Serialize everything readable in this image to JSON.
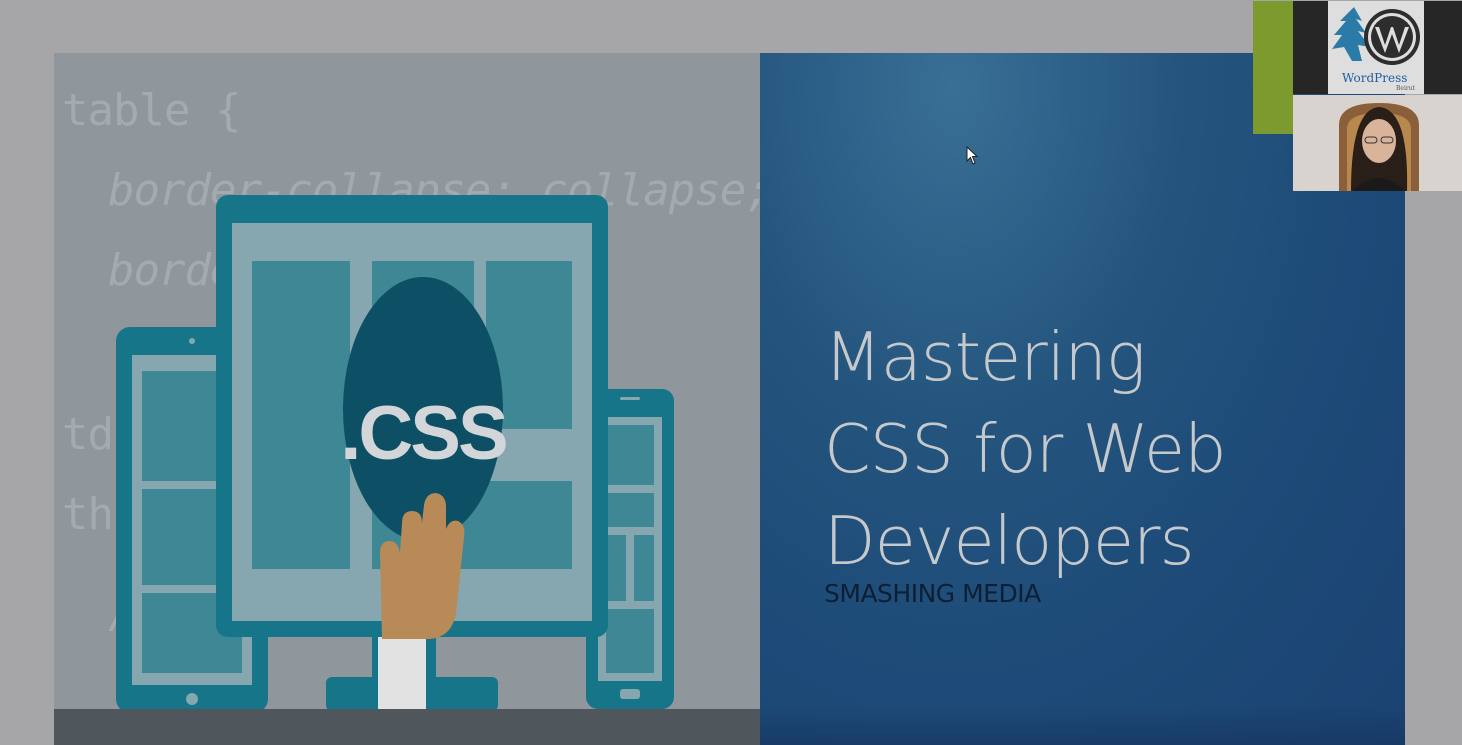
{
  "slide": {
    "code_lines": [
      "table {",
      "border-collapse: collapse;",
      "borde",
      "td",
      "th",
      "/"
    ],
    "badge_text": ".CSS",
    "title": "Mastering\nCSS for Web\nDevelopers",
    "subtitle": "SMASHING MEDIA"
  },
  "logo": {
    "name": "WordPress",
    "city": "Beirut"
  },
  "colors": {
    "slide_left_bg": "#8f979c",
    "slide_right_bg": "#1d4a78",
    "device_teal": "#177589",
    "accent_green": "#7d9a2f",
    "wordpress_blue": "#1e5fa0"
  }
}
